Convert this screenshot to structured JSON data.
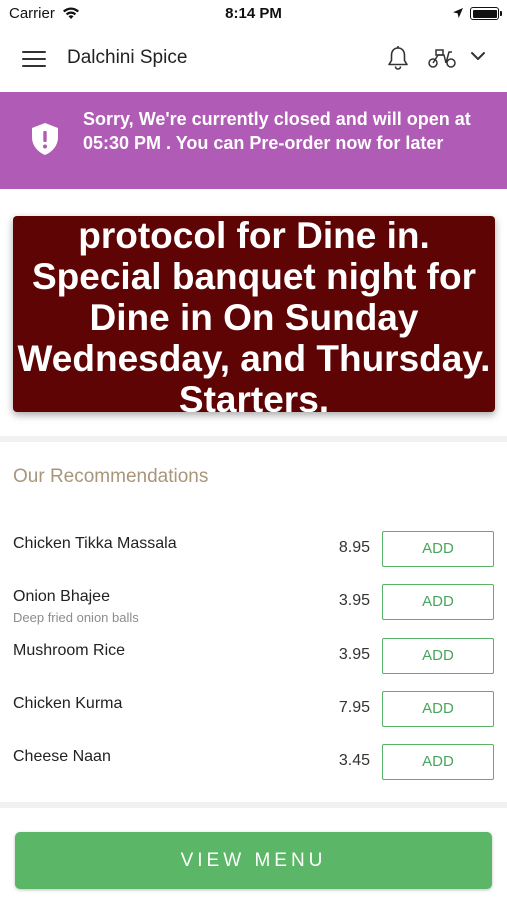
{
  "status_bar": {
    "carrier": "Carrier",
    "time": "8:14 PM"
  },
  "header": {
    "title": "Dalchini Spice",
    "icons": [
      "menu-icon",
      "bell-icon",
      "scooter-icon",
      "chevron-down-icon"
    ]
  },
  "banner": {
    "message": "Sorry, We're currently closed and will open at 05:30 PM . You can Pre-order now for later",
    "color": "#b05bb6",
    "icon": "shield-alert-icon"
  },
  "promo": {
    "text": "protocol for Dine in. Special banquet night for Dine in On Sunday Wednesday, and Thursday. Starters,",
    "background": "#5e0404"
  },
  "recommendations": {
    "title": "Our Recommendations",
    "items": [
      {
        "name": "Chicken Tikka Massala",
        "description": "",
        "price": "8.95",
        "button": "ADD"
      },
      {
        "name": "Onion Bhajee",
        "description": "Deep fried onion balls",
        "price": "3.95",
        "button": "ADD"
      },
      {
        "name": "Mushroom Rice",
        "description": "",
        "price": "3.95",
        "button": "ADD"
      },
      {
        "name": "Chicken Kurma",
        "description": "",
        "price": "7.95",
        "button": "ADD"
      },
      {
        "name": "Cheese Naan",
        "description": "",
        "price": "3.45",
        "button": "ADD"
      }
    ]
  },
  "cta": {
    "label": "VIEW MENU",
    "color": "#5cb667"
  }
}
